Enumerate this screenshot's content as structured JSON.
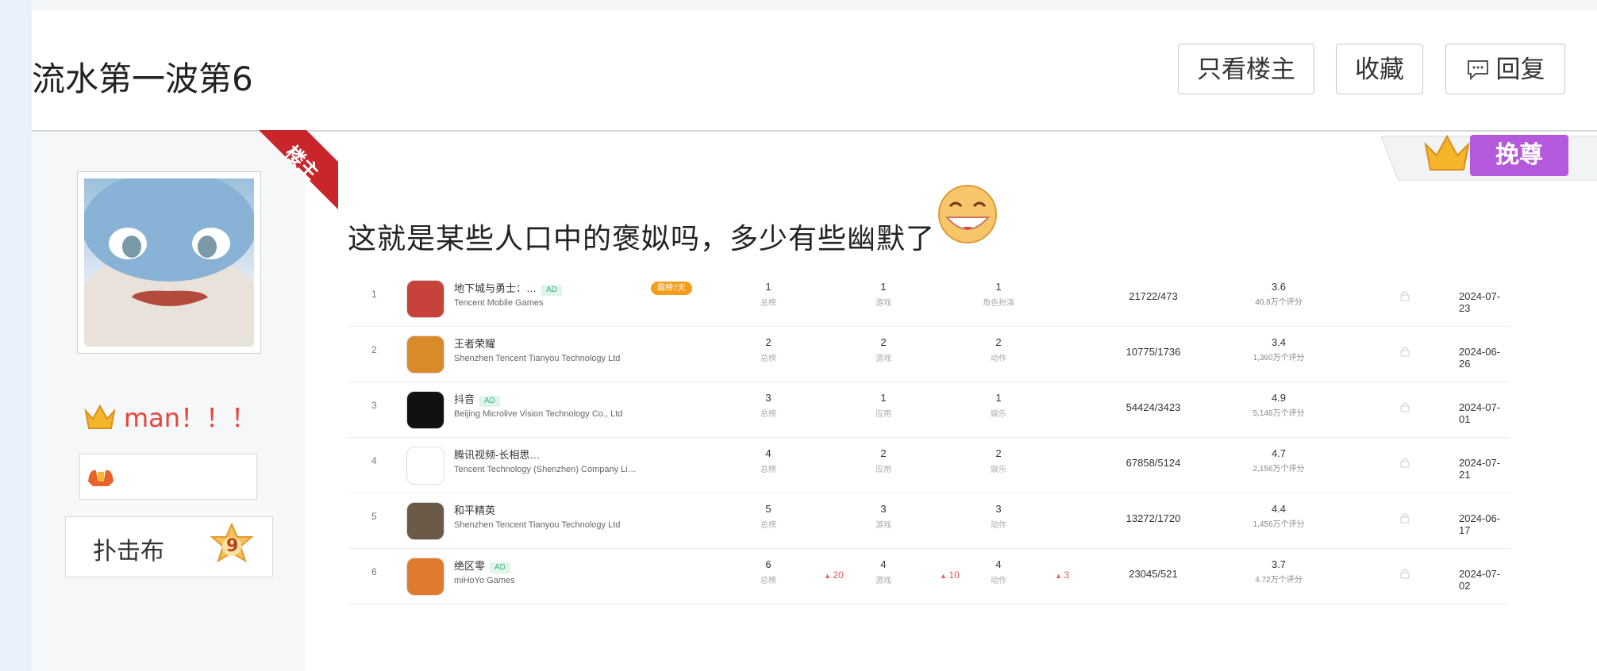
{
  "thread": {
    "title": "流水第一波第6",
    "buttons": {
      "only_op": "只看楼主",
      "favorite": "收藏",
      "reply": "回复"
    }
  },
  "author": {
    "op_ribbon": "楼主",
    "name": "man！！！",
    "level_name": "扑击布",
    "level": "9",
    "vip_label": "挽尊"
  },
  "post": {
    "text": "这就是某些人口中的褒姒吗，多少有些幽默了"
  },
  "ranking": {
    "rows": [
      {
        "index": "1",
        "name": "地下城与勇士：…",
        "ad": "AD",
        "hot": "霸榜7天",
        "publisher": "Tencent Mobile Games",
        "r1": "1",
        "r1_label": "总榜",
        "r2": "1",
        "r2_label": "游戏",
        "r3": "1",
        "r3_label": "角色扮演",
        "volume": "21722/473",
        "score": "3.6",
        "score_count": "40.8万个评分",
        "date": "2024-07-23",
        "icon_color": "#c7423a"
      },
      {
        "index": "2",
        "name": "王者荣耀",
        "publisher": "Shenzhen Tencent Tianyou Technology Ltd",
        "r1": "2",
        "r1_label": "总榜",
        "r2": "2",
        "r2_label": "游戏",
        "r3": "2",
        "r3_label": "动作",
        "volume": "10775/1736",
        "score": "3.4",
        "score_count": "1,360万个评分",
        "date": "2024-06-26",
        "icon_color": "#d98a2b"
      },
      {
        "index": "3",
        "name": "抖音",
        "ad": "AD",
        "publisher": "Beijing Microlive Vision Technology Co., Ltd",
        "r1": "3",
        "r1_label": "总榜",
        "r2": "1",
        "r2_label": "应用",
        "r3": "1",
        "r3_label": "娱乐",
        "volume": "54424/3423",
        "score": "4.9",
        "score_count": "5,146万个评分",
        "date": "2024-07-01",
        "icon_color": "#111111"
      },
      {
        "index": "4",
        "name": "腾讯视频-长相思…",
        "publisher": "Tencent Technology (Shenzhen) Company Li…",
        "r1": "4",
        "r1_label": "总榜",
        "r2": "2",
        "r2_label": "应用",
        "r3": "2",
        "r3_label": "娱乐",
        "volume": "67858/5124",
        "score": "4.7",
        "score_count": "2,156万个评分",
        "date": "2024-07-21",
        "icon_color": "#ffffff"
      },
      {
        "index": "5",
        "name": "和平精英",
        "publisher": "Shenzhen Tencent Tianyou Technology Ltd",
        "r1": "5",
        "r1_label": "总榜",
        "r2": "3",
        "r2_label": "游戏",
        "r3": "3",
        "r3_label": "动作",
        "volume": "13272/1720",
        "score": "4.4",
        "score_count": "1,456万个评分",
        "date": "2024-06-17",
        "icon_color": "#6b5a48"
      },
      {
        "index": "6",
        "name": "绝区零",
        "ad": "AD",
        "publisher": "miHoYo Games",
        "r1": "6",
        "r1_label": "总榜",
        "r1_delta": "20",
        "r2": "4",
        "r2_label": "游戏",
        "r2_delta": "10",
        "r3": "4",
        "r3_label": "动作",
        "r3_delta": "3",
        "volume": "23045/521",
        "score": "3.7",
        "score_count": "4.72万个评分",
        "date": "2024-07-02",
        "icon_color": "#e07a2e"
      }
    ]
  }
}
